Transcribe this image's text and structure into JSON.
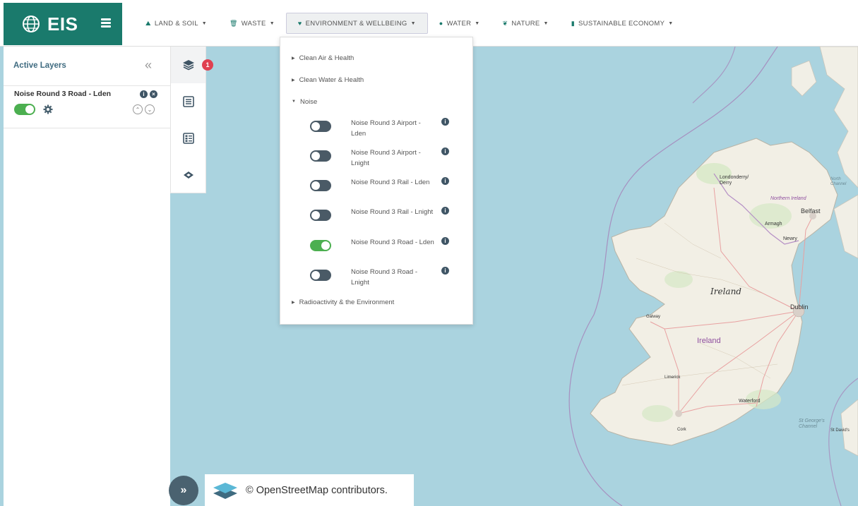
{
  "brand": {
    "title": "EIS",
    "icon": "globe-icon",
    "menu_icon": "hamburger-icon",
    "color": "#1a7a6c"
  },
  "nav": [
    {
      "label": "LAND & SOIL",
      "icon": "land-icon"
    },
    {
      "label": "WASTE",
      "icon": "waste-icon"
    },
    {
      "label": "ENVIRONMENT & WELLBEING",
      "icon": "heart-icon",
      "active": true
    },
    {
      "label": "WATER",
      "icon": "water-drop-icon"
    },
    {
      "label": "NATURE",
      "icon": "leaf-icon"
    },
    {
      "label": "SUSTAINABLE ECONOMY",
      "icon": "chart-icon"
    }
  ],
  "left_panel": {
    "title": "Active Layers",
    "layer": {
      "name": "Noise Round 3 Road - Lden",
      "enabled": true
    }
  },
  "icon_col": {
    "badge": "1"
  },
  "dropdown": {
    "categories": [
      "Clean Air & Health",
      "Clean Water & Health",
      "Noise",
      "Radioactivity & the Environment"
    ],
    "items": [
      {
        "label": "Noise Round 3 Airport - Lden",
        "on": false
      },
      {
        "label": "Noise Round 3 Airport - Lnight",
        "on": false
      },
      {
        "label": "Noise Round 3 Rail - Lden",
        "on": false
      },
      {
        "label": "Noise Round 3 Rail - Lnight",
        "on": false
      },
      {
        "label": "Noise Round 3 Road - Lden",
        "on": true
      },
      {
        "label": "Noise Round 3 Road - Lnight",
        "on": false
      }
    ]
  },
  "map": {
    "labels": {
      "ireland_italic": "Ireland",
      "ireland": "Ireland",
      "dublin": "Dublin",
      "belfast": "Belfast",
      "derry": "Londonderry/\nDerry",
      "armagh": "Armagh",
      "newry": "Newry",
      "ni": "Northern Ireland",
      "north_channel": "North\nChannel",
      "galway": "Galway",
      "limerick": "Limerick",
      "waterford": "Waterford",
      "cork": "Cork",
      "stgeorges": "St George's\nChannel",
      "stdavids": "St David's"
    }
  },
  "attribution": {
    "text": "© OpenStreetMap contributors.",
    "expand": "»"
  }
}
